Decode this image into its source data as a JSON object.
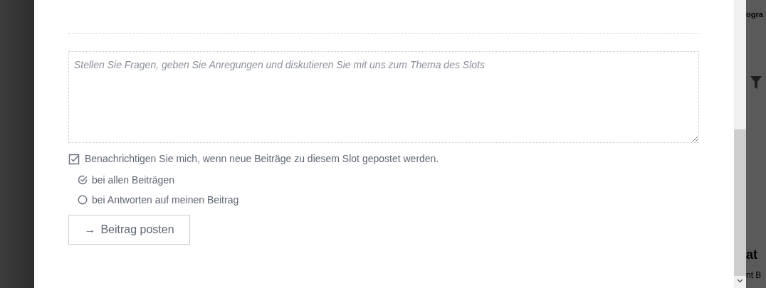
{
  "comment_form": {
    "placeholder": "Stellen Sie Fragen, geben Sie Anregungen und diskutieren Sie mit uns zum Thema des Slots",
    "notify": {
      "label": "Benachrichtigen Sie mich, wenn neue Beiträge zu diesem Slot gepostet werden.",
      "checked": true
    },
    "options": [
      {
        "label": "bei allen Beiträgen",
        "selected": true
      },
      {
        "label": "bei Antworten auf meinen Beitrag",
        "selected": false
      }
    ],
    "submit": {
      "arrow": "→",
      "label": "Beitrag posten"
    }
  },
  "background_page": {
    "texts": [
      "ogra",
      "at",
      "nt B"
    ]
  }
}
